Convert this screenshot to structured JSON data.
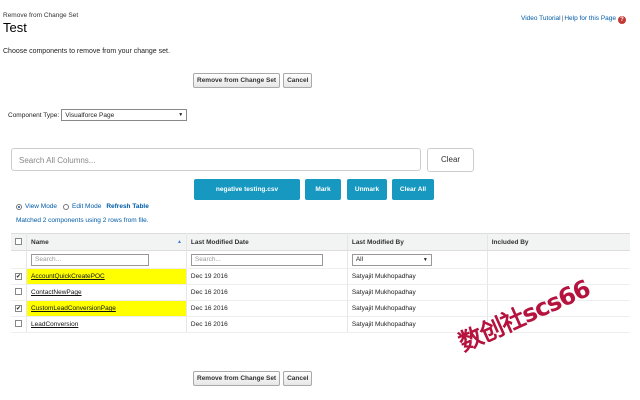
{
  "header": {
    "subtitle": "Remove from Change Set",
    "title": "Test",
    "video_tutorial": "Video Tutorial",
    "separator": "|",
    "help_link": "Help for this Page",
    "help_icon": "?"
  },
  "instructions": "Choose components to remove from your change set.",
  "buttons": {
    "remove": "Remove from Change Set",
    "cancel": "Cancel"
  },
  "component_type": {
    "label": "Component Type:",
    "value": "Visualforce Page"
  },
  "search": {
    "placeholder": "Search All Columns...",
    "clear": "Clear"
  },
  "action_buttons": {
    "file": "negative testing.csv",
    "mark": "Mark",
    "unmark": "Unmark",
    "clear_all": "Clear All"
  },
  "modes": {
    "view": "View Mode",
    "edit": "Edit Mode",
    "refresh": "Refresh Table",
    "selected": "view"
  },
  "matched_text": "Matched 2 components using 2 rows from file.",
  "table": {
    "headers": {
      "name": "Name",
      "last_modified_date": "Last Modified Date",
      "last_modified_by": "Last Modified By",
      "included_by": "Included By"
    },
    "filters": {
      "name_placeholder": "Search...",
      "date_placeholder": "Search...",
      "by_value": "All"
    },
    "rows": [
      {
        "checked": true,
        "name": "AccountQuickCreatePOC",
        "date": "Dec 19 2016",
        "by": "Satyajit Mukhopadhay",
        "included_by": "",
        "highlight": true
      },
      {
        "checked": false,
        "name": "ContactNewPage",
        "date": "Dec 16 2016",
        "by": "Satyajit Mukhopadhay",
        "included_by": "",
        "highlight": false
      },
      {
        "checked": true,
        "name": "CustomLeadConversionPage",
        "date": "Dec 16 2016",
        "by": "Satyajit Mukhopadhay",
        "included_by": "",
        "highlight": true
      },
      {
        "checked": false,
        "name": "LeadConversion",
        "date": "Dec 16 2016",
        "by": "Satyajit Mukhopadhay",
        "included_by": "",
        "highlight": false
      }
    ]
  },
  "watermark": "数创社scs66",
  "colors": {
    "accent_blue": "#1798c1",
    "link_blue": "#015ba7",
    "highlight_yellow": "#ffff00",
    "watermark_red": "#b5123e"
  }
}
